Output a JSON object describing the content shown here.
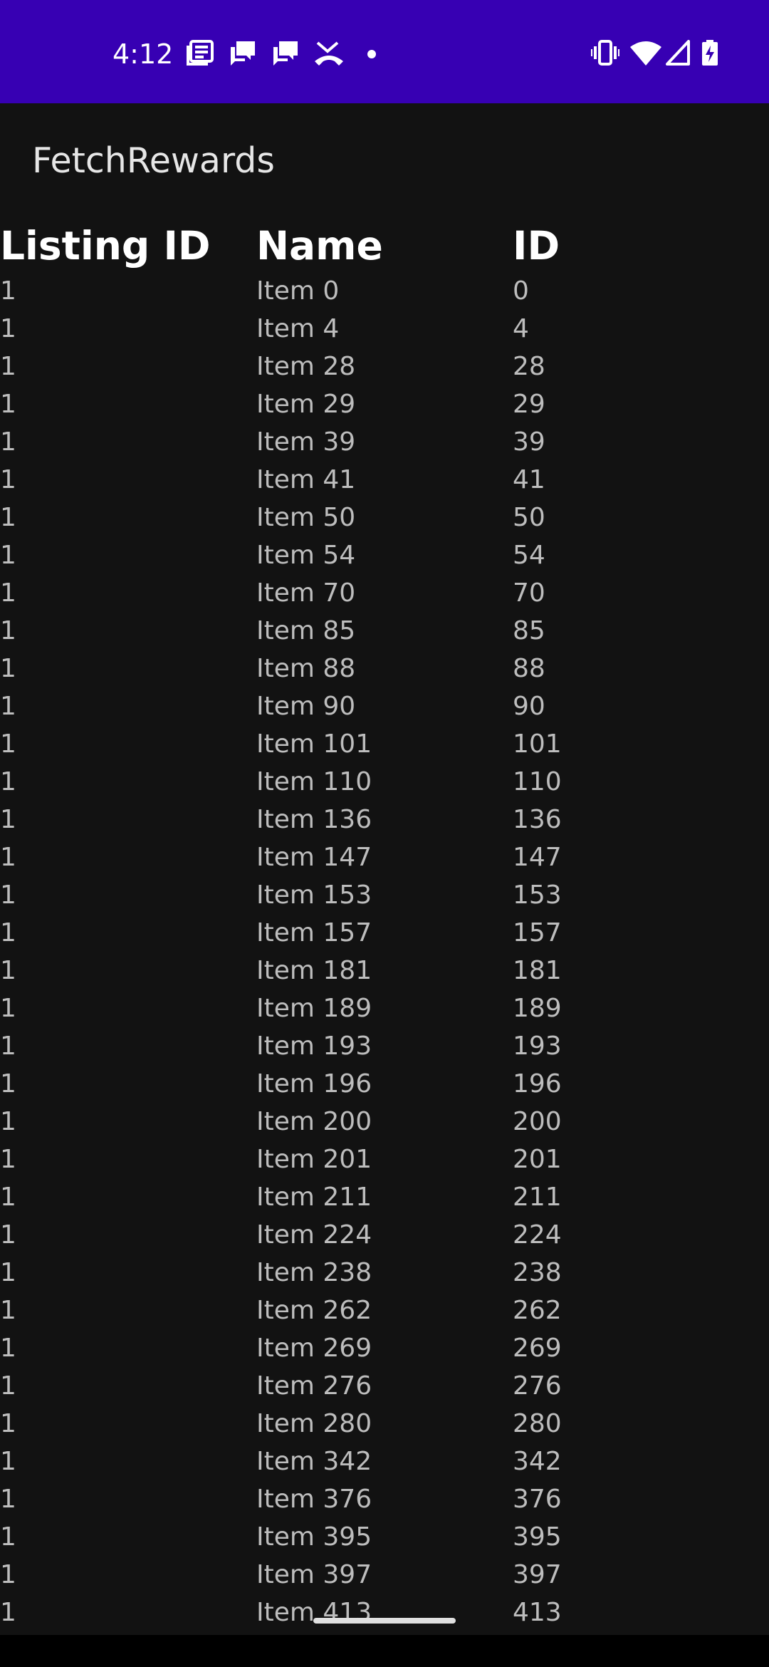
{
  "status_bar": {
    "time": "4:12",
    "left_icons": [
      "news-icon",
      "chat-icon",
      "chat-icon",
      "missed-call-icon",
      "dot-icon"
    ],
    "right_icons": [
      "vibrate-icon",
      "wifi-icon",
      "signal-icon",
      "battery-charging-icon"
    ],
    "background": "#3700B3"
  },
  "app": {
    "title": "FetchRewards"
  },
  "table": {
    "headers": [
      "Listing ID",
      "Name",
      "ID"
    ],
    "rows": [
      [
        "1",
        "Item 0",
        "0"
      ],
      [
        "1",
        "Item 4",
        "4"
      ],
      [
        "1",
        "Item 28",
        "28"
      ],
      [
        "1",
        "Item 29",
        "29"
      ],
      [
        "1",
        "Item 39",
        "39"
      ],
      [
        "1",
        "Item 41",
        "41"
      ],
      [
        "1",
        "Item 50",
        "50"
      ],
      [
        "1",
        "Item 54",
        "54"
      ],
      [
        "1",
        "Item 70",
        "70"
      ],
      [
        "1",
        "Item 85",
        "85"
      ],
      [
        "1",
        "Item 88",
        "88"
      ],
      [
        "1",
        "Item 90",
        "90"
      ],
      [
        "1",
        "Item 101",
        "101"
      ],
      [
        "1",
        "Item 110",
        "110"
      ],
      [
        "1",
        "Item 136",
        "136"
      ],
      [
        "1",
        "Item 147",
        "147"
      ],
      [
        "1",
        "Item 153",
        "153"
      ],
      [
        "1",
        "Item 157",
        "157"
      ],
      [
        "1",
        "Item 181",
        "181"
      ],
      [
        "1",
        "Item 189",
        "189"
      ],
      [
        "1",
        "Item 193",
        "193"
      ],
      [
        "1",
        "Item 196",
        "196"
      ],
      [
        "1",
        "Item 200",
        "200"
      ],
      [
        "1",
        "Item 201",
        "201"
      ],
      [
        "1",
        "Item 211",
        "211"
      ],
      [
        "1",
        "Item 224",
        "224"
      ],
      [
        "1",
        "Item 238",
        "238"
      ],
      [
        "1",
        "Item 262",
        "262"
      ],
      [
        "1",
        "Item 269",
        "269"
      ],
      [
        "1",
        "Item 276",
        "276"
      ],
      [
        "1",
        "Item 280",
        "280"
      ],
      [
        "1",
        "Item 342",
        "342"
      ],
      [
        "1",
        "Item 376",
        "376"
      ],
      [
        "1",
        "Item 395",
        "395"
      ],
      [
        "1",
        "Item 397",
        "397"
      ],
      [
        "1",
        "Item 413",
        "413"
      ]
    ]
  },
  "colors": {
    "background": "#121212",
    "header_text": "#FFFFFF",
    "cell_text": "#BDBDBD",
    "nav_bar": "#000000"
  }
}
